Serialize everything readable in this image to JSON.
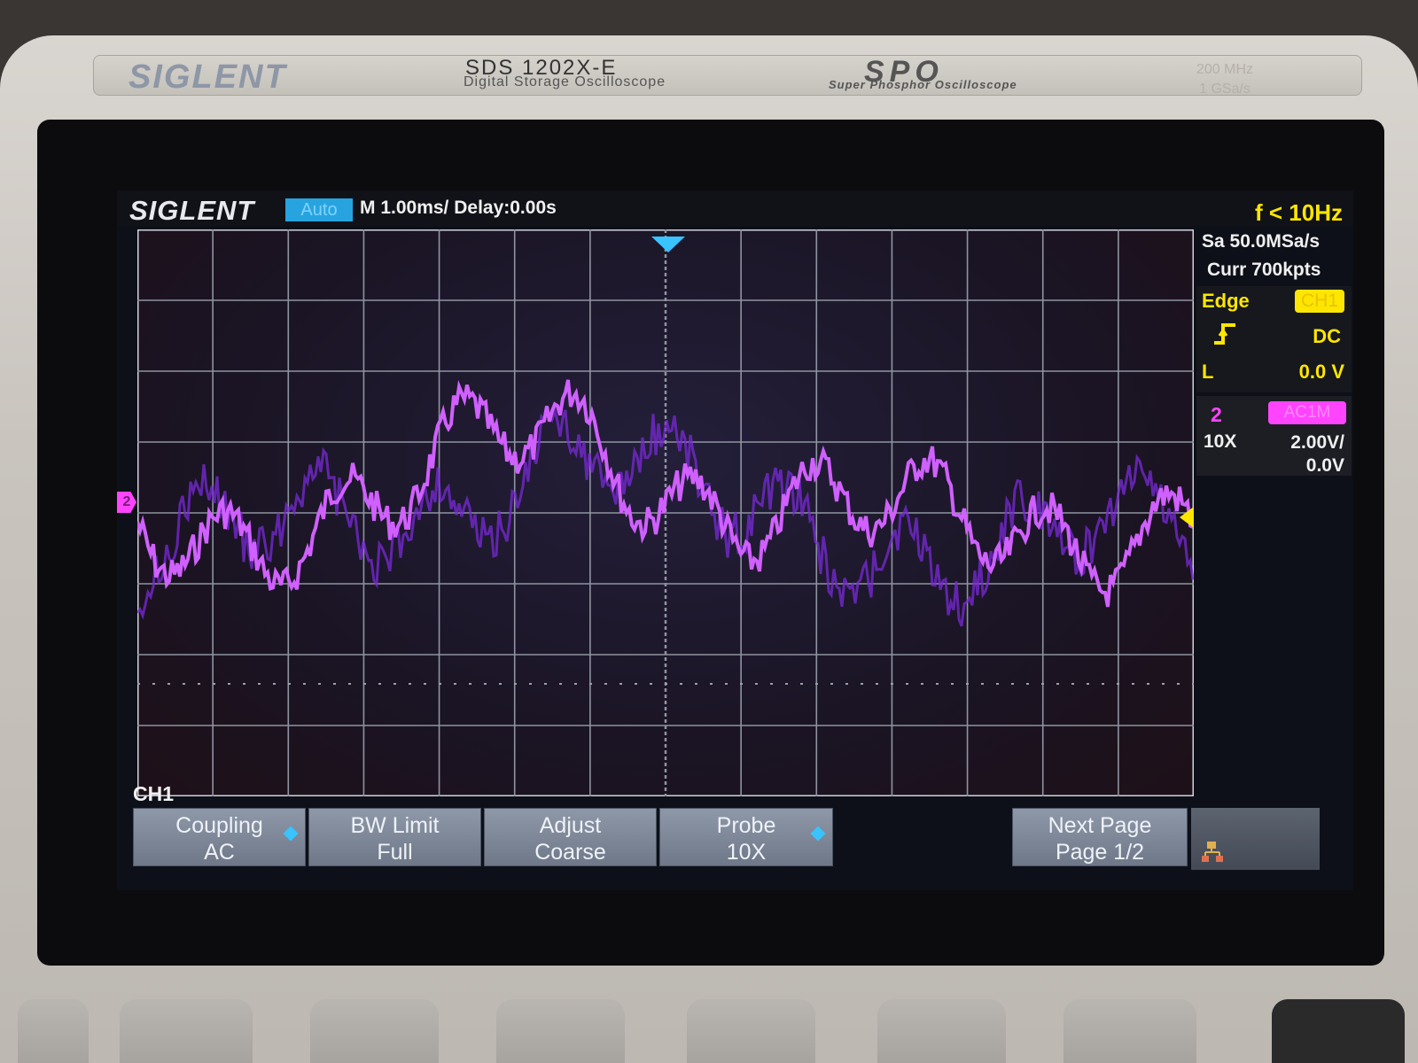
{
  "device": {
    "brand": "SIGLENT",
    "model": "SDS 1202X-E",
    "model_subtitle": "Digital Storage Oscilloscope",
    "spo_logo": "SPO",
    "spo_subtitle": "Super Phosphor Oscilloscope",
    "spec_bandwidth": "200 MHz",
    "spec_samplerate": "1 GSa/s"
  },
  "screen": {
    "logo": "SIGLENT",
    "trigger_mode": "Auto",
    "timebase": "M 1.00ms/ Delay:0.00s",
    "frequency": "f < 10Hz",
    "sample_rate": "Sa 50.0MSa/s",
    "memory_depth": "Curr 700kpts",
    "trigger": {
      "type": "Edge",
      "source": "CH1",
      "slope_icon": "rising-edge-icon",
      "coupling": "DC",
      "level_label": "L",
      "level": "0.0 V"
    },
    "channel2": {
      "number": "2",
      "coupling_badge": "AC1M",
      "probe": "10X",
      "scale": "2.00V/",
      "offset": "0.0V"
    },
    "channel_marker": "2",
    "menu_title": "CH1",
    "softkeys": [
      {
        "line1": "Coupling",
        "line2": "AC"
      },
      {
        "line1": "BW Limit",
        "line2": "Full"
      },
      {
        "line1": "Adjust",
        "line2": "Coarse"
      },
      {
        "line1": "Probe",
        "line2": "10X"
      },
      {
        "line1": "Next Page",
        "line2": "Page 1/2"
      }
    ],
    "colors": {
      "ch1": "#ffe600",
      "ch2": "#ff44ff",
      "trace": "#c050ff",
      "accent": "#27a4e0"
    }
  }
}
